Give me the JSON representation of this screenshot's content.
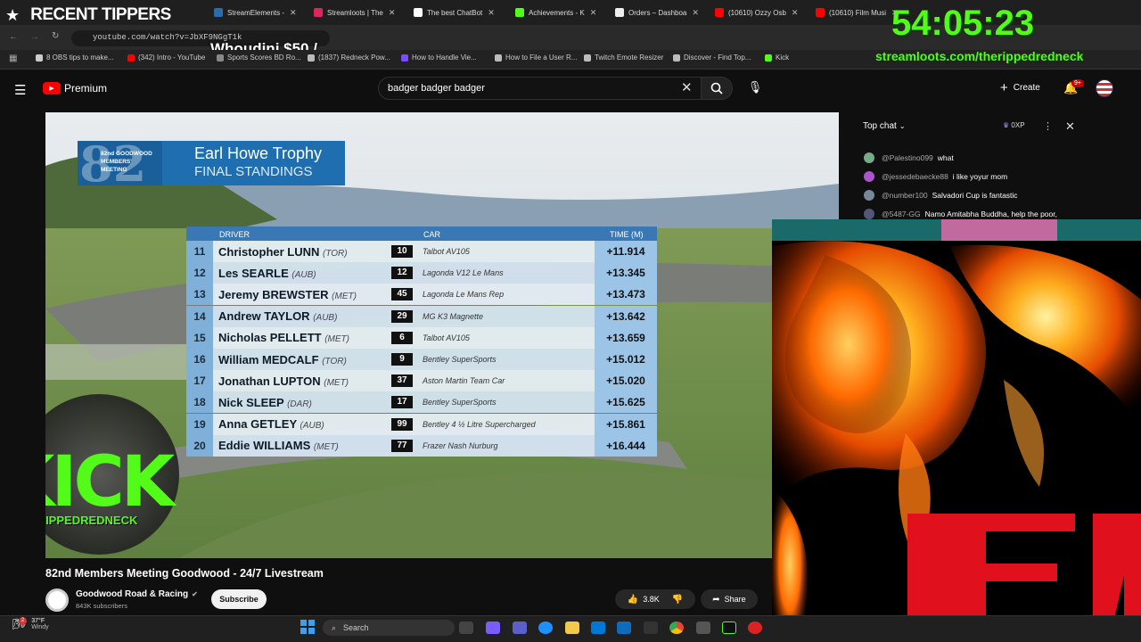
{
  "stream_overlay": {
    "recent_tippers_label": "RECENT TIPPERS",
    "tipper_text": "Whoudini $50 /",
    "timer": "54:05:23",
    "url_text": "streamloots.com/therippedredneck",
    "kick_logo_text": "KICK",
    "kick_handle": "@THERIPPEDREDNECK"
  },
  "browser": {
    "tabs": [
      {
        "label": "StreamElements -",
        "color": "#2b6cb0"
      },
      {
        "label": "Streamloots | The",
        "color": "#e0245e"
      },
      {
        "label": "The best ChatBot",
        "color": "#fff"
      },
      {
        "label": "Achievements - K",
        "color": "#53fc18"
      },
      {
        "label": "Orders – Dashboa",
        "color": "#eee"
      },
      {
        "label": "(10610) Ozzy Osb",
        "color": "#ff0000"
      },
      {
        "label": "(10610) Film Musi",
        "color": "#ff0000"
      }
    ],
    "url": "youtube.com/watch?v=JbXF9NGgT1k",
    "bookmarks": [
      "8 OBS tips to make...",
      "(342) Intro - YouTube",
      "Sports Scores BD Ro...",
      "(1837) Redneck Pow...",
      "How to Handle Vie...",
      "How to File a User R...",
      "Twitch Emote Resizer",
      "Discover - Find Top...",
      "Kick"
    ]
  },
  "youtube": {
    "logo_label": "Premium",
    "search_value": "badger badger badger",
    "create_label": "Create",
    "notification_badge": "9+",
    "video_title": "82nd Members Meeting Goodwood - 24/7 Livestream",
    "channel_name": "Goodwood Road & Racing",
    "subscribers": "843K subscribers",
    "subscribe_label": "Subscribe",
    "likes": "3.8K",
    "share_label": "Share"
  },
  "chat": {
    "mode_label": "Top chat",
    "xp_label": "0XP",
    "messages": [
      {
        "user": "@Palestino099",
        "text": "what"
      },
      {
        "user": "@jessedebaecke88",
        "text": "i like yoyur mom"
      },
      {
        "user": "@number100",
        "text": "Salvadori Cup is fantastic"
      },
      {
        "user": "@5487-GG",
        "text": "Namo Amitabha Buddha, help the poor,"
      }
    ]
  },
  "standings": {
    "event_logo": "82",
    "event_logo_sub": "82nd GOODWOOD MEMBERS' MEETING",
    "trophy": "Earl Howe Trophy",
    "subtitle": "FINAL STANDINGS",
    "headers": {
      "driver": "DRIVER",
      "car": "CAR",
      "time": "TIME (M)"
    },
    "rows": [
      {
        "pos": "11",
        "name": "Christopher LUNN",
        "nat": "(TOR)",
        "num": "10",
        "car": "Talbot AV105",
        "time": "+11.914"
      },
      {
        "pos": "12",
        "name": "Les SEARLE",
        "nat": "(AUB)",
        "num": "12",
        "car": "Lagonda V12 Le Mans",
        "time": "+13.345"
      },
      {
        "pos": "13",
        "name": "Jeremy BREWSTER",
        "nat": "(MET)",
        "num": "45",
        "car": "Lagonda Le Mans Rep",
        "time": "+13.473"
      },
      {
        "pos": "14",
        "name": "Andrew TAYLOR",
        "nat": "(AUB)",
        "num": "29",
        "car": "MG K3 Magnette",
        "time": "+13.642"
      },
      {
        "pos": "15",
        "name": "Nicholas PELLETT",
        "nat": "(MET)",
        "num": "6",
        "car": "Talbot AV105",
        "time": "+13.659"
      },
      {
        "pos": "16",
        "name": "William MEDCALF",
        "nat": "(TOR)",
        "num": "9",
        "car": "Bentley SuperSports",
        "time": "+15.012"
      },
      {
        "pos": "17",
        "name": "Jonathan LUPTON",
        "nat": "(MET)",
        "num": "37",
        "car": "Aston Martin Team Car",
        "time": "+15.020"
      },
      {
        "pos": "18",
        "name": "Nick SLEEP",
        "nat": "(DAR)",
        "num": "17",
        "car": "Bentley SuperSports",
        "time": "+15.625"
      },
      {
        "pos": "19",
        "name": "Anna GETLEY",
        "nat": "(AUB)",
        "num": "99",
        "car": "Bentley 4 ½ Litre Supercharged",
        "time": "+15.861"
      },
      {
        "pos": "20",
        "name": "Eddie WILLIAMS",
        "nat": "(MET)",
        "num": "77",
        "car": "Frazer Nash Nurburg",
        "time": "+16.444"
      }
    ]
  },
  "taskbar": {
    "weather_temp": "37°F",
    "weather_desc": "Windy",
    "weather_badge": "2",
    "search_label": "Search"
  }
}
